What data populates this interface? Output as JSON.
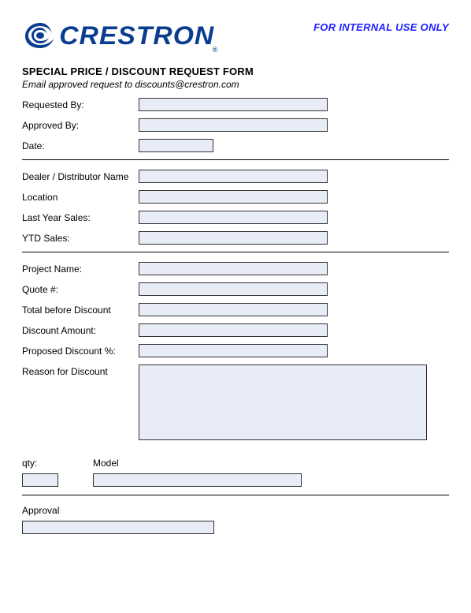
{
  "header": {
    "logo_text": "CRESTRON",
    "internal_label": "FOR INTERNAL USE ONLY"
  },
  "title": "SPECIAL PRICE / DISCOUNT REQUEST FORM",
  "subtitle": "Email approved request to discounts@crestron.com",
  "section1": {
    "requested_by": "Requested By:",
    "approved_by": "Approved By:",
    "date": "Date:"
  },
  "section2": {
    "dealer": "Dealer / Distributor Name",
    "location": "Location",
    "last_year": "Last Year Sales:",
    "ytd": "YTD Sales:"
  },
  "section3": {
    "project": "Project Name:",
    "quote": "Quote #:",
    "total_before": "Total before Discount",
    "discount_amt": "Discount Amount:",
    "proposed_pct": "Proposed Discount %:",
    "reason": "Reason for Discount"
  },
  "section4": {
    "qty": "qty:",
    "model": "Model"
  },
  "section5": {
    "approval": "Approval"
  }
}
